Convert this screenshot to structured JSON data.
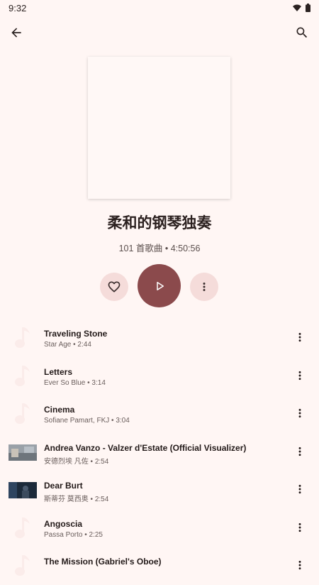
{
  "status": {
    "time": "9:32"
  },
  "playlist": {
    "title": "柔和的钢琴独奏",
    "meta": "101 首歌曲 • 4:50:56"
  },
  "colors": {
    "background": "#fff6f4",
    "accent": "#8b4a4c",
    "chip": "#f5dcda"
  },
  "songs": [
    {
      "title": "Traveling Stone",
      "subtitle": "Star Age • 2:44",
      "thumb": "music-note-icon"
    },
    {
      "title": "Letters",
      "subtitle": "Ever So Blue • 3:14",
      "thumb": "music-note-icon"
    },
    {
      "title": "Cinema",
      "subtitle": "Sofiane Pamart, FKJ • 3:04",
      "thumb": "music-note-icon"
    },
    {
      "title": "Andrea Vanzo - Valzer d'Estate (Official Visualizer)",
      "subtitle": "安德烈埃 凡佐 • 2:54",
      "thumb": "video-thumbnail"
    },
    {
      "title": "Dear Burt",
      "subtitle": "斯蒂芬 莫西奥 • 2:54",
      "thumb": "video-thumbnail"
    },
    {
      "title": "Angoscia",
      "subtitle": "Passa Porto • 2:25",
      "thumb": "music-note-icon"
    },
    {
      "title": "The Mission (Gabriel's Oboe)",
      "subtitle": "",
      "thumb": "music-note-icon"
    }
  ]
}
